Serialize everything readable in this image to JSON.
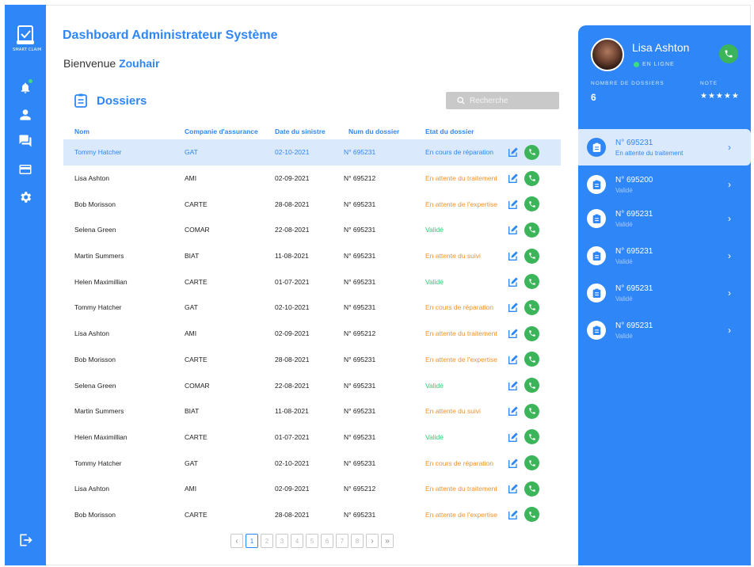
{
  "app": {
    "logo_text": "SMART CLAIM"
  },
  "header": {
    "title": "Dashboard Administrateur Système",
    "welcome_prefix": "Bienvenue",
    "welcome_name": "Zouhair"
  },
  "section": {
    "title": "Dossiers"
  },
  "search": {
    "placeholder": "Recherche"
  },
  "table": {
    "columns": [
      "Nom",
      "Companie d'assurance",
      "Date du sinistre",
      "Num du dossier",
      "Etat du dossier"
    ],
    "rows": [
      {
        "name": "Tommy Hatcher",
        "company": "GAT",
        "date": "02-10-2021",
        "num": "N° 695231",
        "status": "En cours de réparation",
        "tone": "orange"
      },
      {
        "name": "Lisa Ashton",
        "company": "AMI",
        "date": "02-09-2021",
        "num": "N° 695212",
        "status": "En attente du traitement",
        "tone": "orange"
      },
      {
        "name": "Bob Morisson",
        "company": "CARTE",
        "date": "28-08-2021",
        "num": "N° 695231",
        "status": "En attente de l'expertise",
        "tone": "orange"
      },
      {
        "name": "Selena Green",
        "company": "COMAR",
        "date": "22-08-2021",
        "num": "N° 695231",
        "status": "Validé",
        "tone": "green"
      },
      {
        "name": "Martin Summers",
        "company": "BIAT",
        "date": "11-08-2021",
        "num": "N° 695231",
        "status": "En attente du suivi",
        "tone": "orange"
      },
      {
        "name": "Helen Maximillian",
        "company": "CARTE",
        "date": "01-07-2021",
        "num": "N° 695231",
        "status": "Validé",
        "tone": "green"
      },
      {
        "name": "Tommy Hatcher",
        "company": "GAT",
        "date": "02-10-2021",
        "num": "N° 695231",
        "status": "En cours de réparation",
        "tone": "orange"
      },
      {
        "name": "Lisa Ashton",
        "company": "AMI",
        "date": "02-09-2021",
        "num": "N° 695212",
        "status": "En attente du traitement",
        "tone": "orange"
      },
      {
        "name": "Bob Morisson",
        "company": "CARTE",
        "date": "28-08-2021",
        "num": "N° 695231",
        "status": "En attente de l'expertise",
        "tone": "orange"
      },
      {
        "name": "Selena Green",
        "company": "COMAR",
        "date": "22-08-2021",
        "num": "N° 695231",
        "status": "Validé",
        "tone": "green"
      },
      {
        "name": "Martin Summers",
        "company": "BIAT",
        "date": "11-08-2021",
        "num": "N° 695231",
        "status": "En attente du suivi",
        "tone": "orange"
      },
      {
        "name": "Helen Maximillian",
        "company": "CARTE",
        "date": "01-07-2021",
        "num": "N° 695231",
        "status": "Validé",
        "tone": "green"
      },
      {
        "name": "Tommy Hatcher",
        "company": "GAT",
        "date": "02-10-2021",
        "num": "N° 695231",
        "status": "En cours de réparation",
        "tone": "orange"
      },
      {
        "name": "Lisa Ashton",
        "company": "AMI",
        "date": "02-09-2021",
        "num": "N° 695212",
        "status": "En attente du traitement",
        "tone": "orange"
      },
      {
        "name": "Bob Morisson",
        "company": "CARTE",
        "date": "28-08-2021",
        "num": "N° 695231",
        "status": "En attente de l'expertise",
        "tone": "orange"
      }
    ],
    "selected_index": 0
  },
  "pagination": {
    "pages": [
      "1",
      "2",
      "3",
      "4",
      "5",
      "6",
      "7",
      "8"
    ],
    "current": "1",
    "prev": "‹",
    "next": "›",
    "last": "»"
  },
  "profile": {
    "name": "Lisa Ashton",
    "status": "EN LIGNE",
    "dossiers_label": "NOMBRE DE DOSSIERS",
    "dossiers_value": "6",
    "note_label": "NOTE",
    "stars": "★★★★★"
  },
  "cases": [
    {
      "num": "N° 695231",
      "status": "En attente du traitement"
    },
    {
      "num": "N° 695200",
      "status": "Validé"
    },
    {
      "num": "N° 695231",
      "status": "Validé"
    },
    {
      "num": "N° 695231",
      "status": "Validé"
    },
    {
      "num": "N° 695231",
      "status": "Validé"
    },
    {
      "num": "N° 695231",
      "status": "Validé"
    }
  ],
  "colors": {
    "accent": "#2f86f6",
    "orange": "#f0932b",
    "green": "#2ecc71",
    "call": "#3cb55a",
    "selected_row": "#dbe9fd"
  }
}
